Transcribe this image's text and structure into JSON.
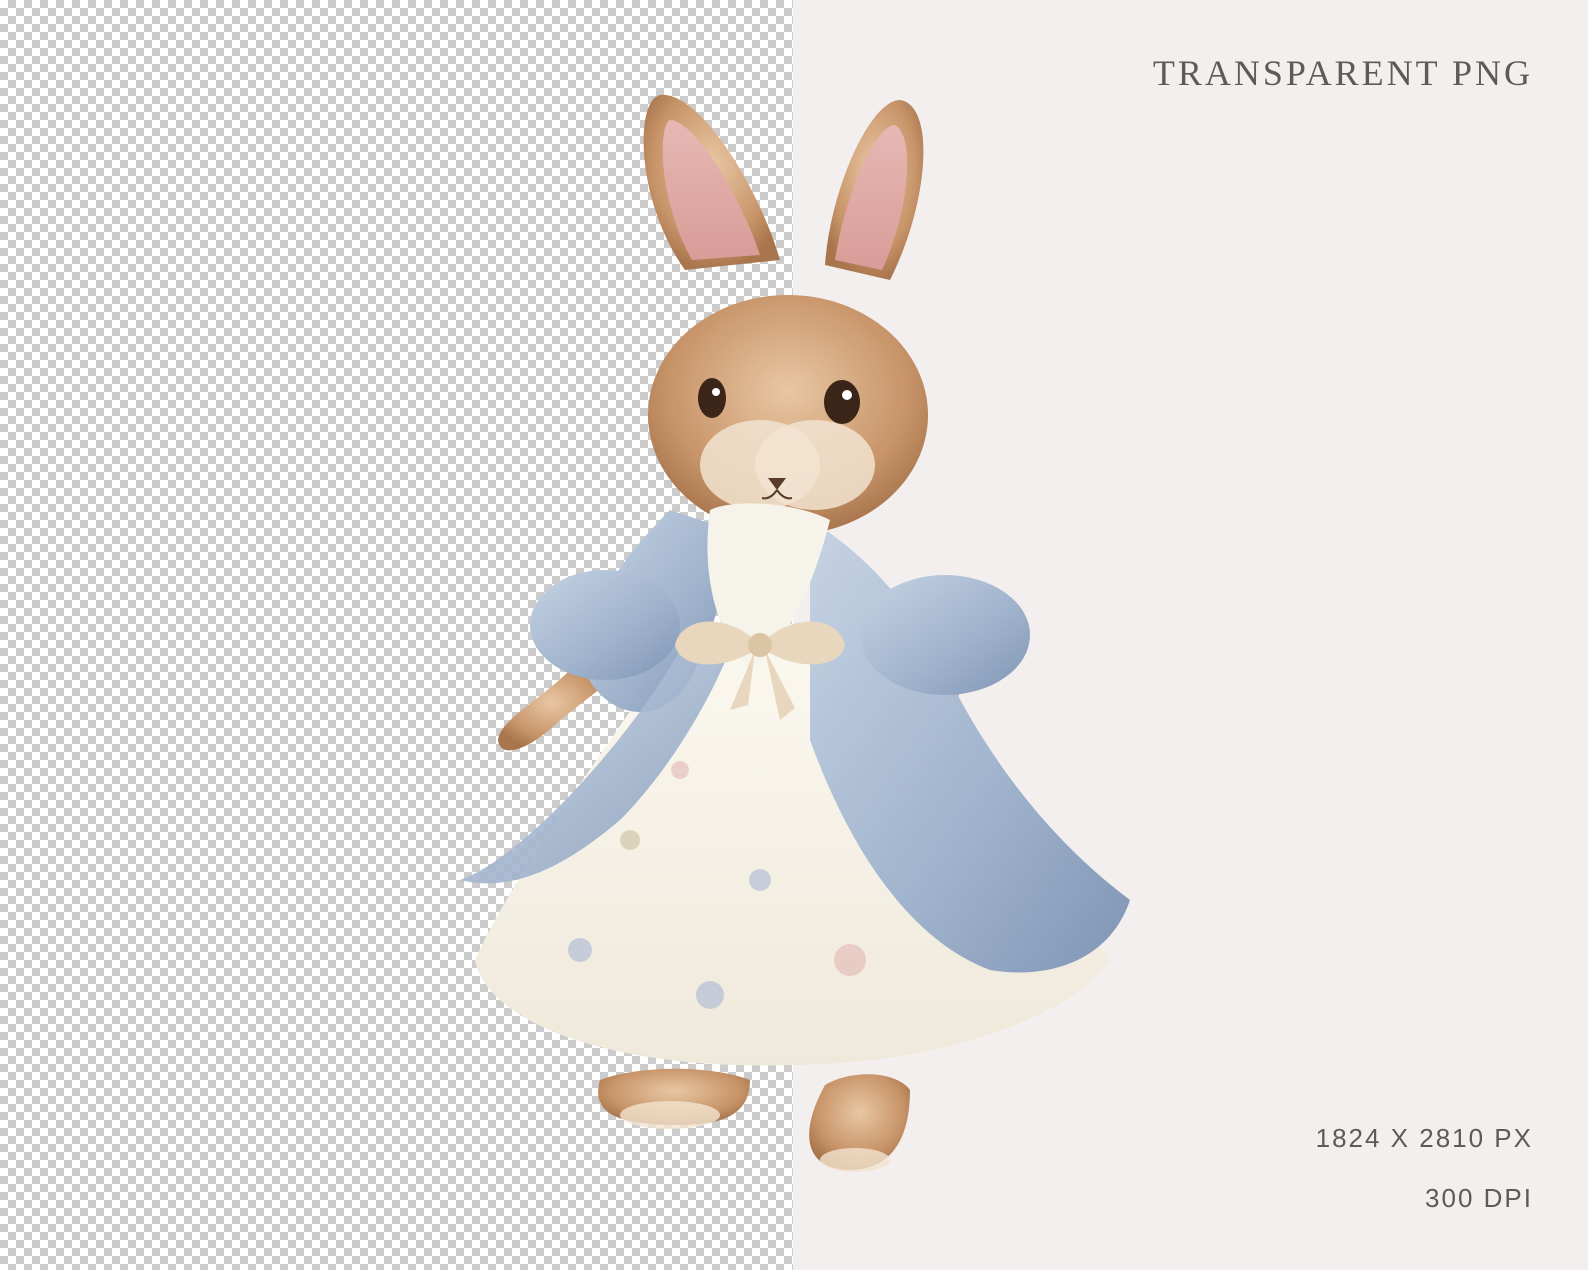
{
  "labels": {
    "title": "TRANSPARENT PNG",
    "dimensions": "1824 X 2810 PX",
    "resolution": "300 DPI"
  },
  "colors": {
    "checker_light": "#ffffff",
    "checker_dark": "#cccccc",
    "panel_background": "#f3efee",
    "label_text": "#5e5a55",
    "fur": "#c9956a",
    "dress_blue": "#9fb2cc",
    "dress_cream": "#f4f0e6"
  },
  "illustration": {
    "subject": "bunny-in-dress-icon"
  }
}
